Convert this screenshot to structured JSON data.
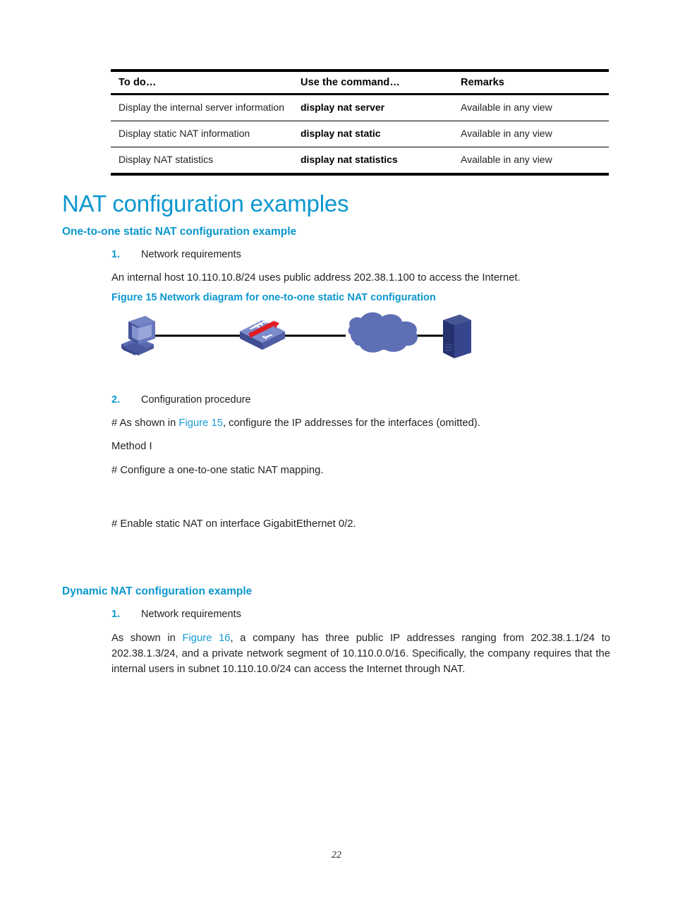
{
  "document": {
    "page_number": "22",
    "accent_color": "#0b97cf",
    "link_color": "#169bd5",
    "text_color": "#231f20"
  },
  "command_table": {
    "headers": [
      "To do…",
      "Use the command…",
      "Remarks"
    ],
    "rows": [
      {
        "todo": "Display the internal server information",
        "command": "display nat server",
        "remarks": "Available in any view"
      },
      {
        "todo": "Display static NAT information",
        "command": "display nat static",
        "remarks": "Available in any view"
      },
      {
        "todo": "Display NAT statistics",
        "command": "display nat statistics",
        "remarks": "Available in any view"
      }
    ]
  },
  "sections": {
    "main_heading": "NAT configuration examples",
    "static_nat": {
      "heading": "One-to-one static NAT configuration example",
      "item1_number": "1.",
      "item1_label": "Network requirements",
      "requirements_text": "An internal host 10.110.10.8/24 uses public address 202.38.1.100 to access the Internet.",
      "figure_caption": "Figure 15 Network diagram for one-to-one static NAT configuration",
      "item2_number": "2.",
      "item2_label": "Configuration procedure",
      "as_shown_prefix": "# As shown in ",
      "as_shown_link": "Figure 15",
      "as_shown_suffix": ", configure the IP addresses for the interfaces (omitted).",
      "method_label": "Method I",
      "configure_mapping_text": "# Configure a one-to-one static NAT mapping.",
      "enable_static_text": "# Enable static NAT on interface GigabitEthernet 0/2."
    },
    "dynamic_nat": {
      "heading": "Dynamic NAT configuration example",
      "item1_number": "1.",
      "item1_label": "Network requirements",
      "requirements_prefix": "As shown in ",
      "requirements_link": "Figure 16",
      "requirements_suffix": ", a company has three public IP addresses ranging from 202.38.1.1/24 to 202.38.1.3/24, and a private network segment of 10.110.0.0/16. Specifically, the company requires that the internal users in subnet 10.110.10.0/24 can access the Internet through NAT."
    }
  },
  "figure15": {
    "nodes": [
      "host-pc",
      "router",
      "internet-cloud",
      "server"
    ],
    "colors": {
      "device_blue": "#5b6ab0",
      "device_blue_dark": "#3b4a8f",
      "device_blue_light": "#7c8ac8",
      "cloud": "#5e6fb5",
      "server_dark": "#2c3a7e",
      "router_top": "#7b8ccc",
      "router_arrow_red": "#e01b24",
      "line": "#000000"
    }
  }
}
